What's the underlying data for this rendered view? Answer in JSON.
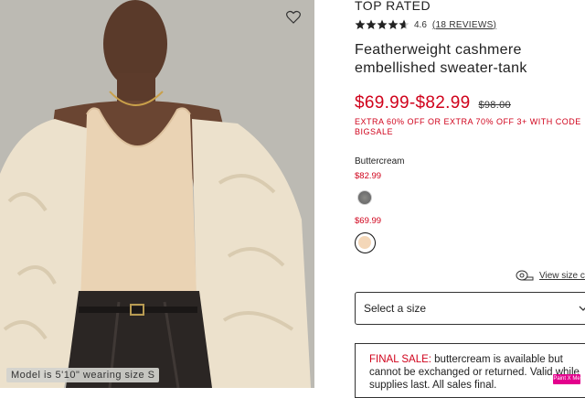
{
  "photo": {
    "alt_semantics": "model wearing cream sweater-tank with faux fur jacket and black leather pants",
    "caption": "Model is 5'10\" wearing size S",
    "wishlist_icon": "heart-outline-icon"
  },
  "product": {
    "badge": "TOP RATED",
    "rating": "4.6",
    "rating_stars": 4.6,
    "reviews": "(18 REVIEWS)",
    "title": "Featherweight cashmere embellished sweater-tank",
    "price_range": "$69.99-$82.99",
    "original_price": "$98.00",
    "promo": "EXTRA 60% OFF OR EXTRA 70% OFF 3+ WITH CODE BIGSALE"
  },
  "colors": {
    "selected_name": "Buttercream",
    "options": [
      {
        "price": "$82.99",
        "swatch_color": "#7a7a78",
        "icon": "heather-grey-swatch"
      },
      {
        "price": "$69.99",
        "swatch_color": "#f4d7b8",
        "icon": "buttercream-swatch",
        "selected": true
      }
    ]
  },
  "size": {
    "chart_link": "View size ch",
    "chart_icon": "measuring-tape-icon",
    "select_placeholder": "Select a size",
    "chevron_icon": "chevron-down-icon"
  },
  "final_sale": {
    "label": "FINAL SALE:",
    "text": " buttercream is available but cannot be exchanged or returned. Valid while supplies last. All sales final."
  },
  "extension_badge": "Paint X Me",
  "colors_theme": {
    "sale_red": "#d0021b",
    "text": "#222222"
  }
}
